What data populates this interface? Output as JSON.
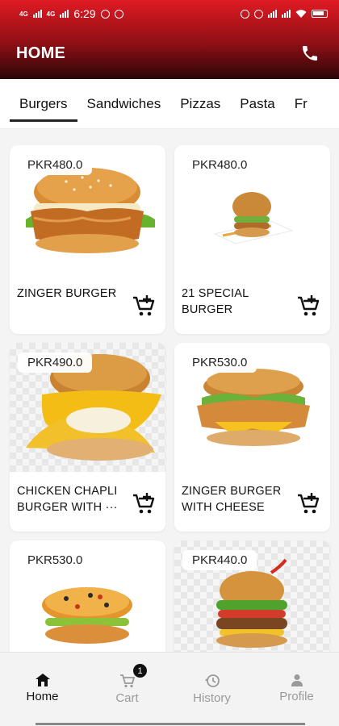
{
  "status_bar": {
    "time": "6:29",
    "battery": "82"
  },
  "header": {
    "title": "HOME",
    "icon": "phone-icon"
  },
  "tabs": [
    {
      "label": "Burgers",
      "active": true
    },
    {
      "label": "Sandwiches",
      "active": false
    },
    {
      "label": "Pizzas",
      "active": false
    },
    {
      "label": "Pasta",
      "active": false
    },
    {
      "label": "Fr",
      "active": false
    }
  ],
  "products": [
    {
      "price": "PKR480.0",
      "name": "ZINGER BURGER"
    },
    {
      "price": "PKR480.0",
      "name": "21 SPECIAL BURGER"
    },
    {
      "price": "PKR490.0",
      "name": "CHICKEN CHAPLI BURGER WITH ···"
    },
    {
      "price": "PKR530.0",
      "name": "ZINGER BURGER WITH CHEESE"
    },
    {
      "price": "PKR530.0",
      "name": ""
    },
    {
      "price": "PKR440.0",
      "name": ""
    }
  ],
  "bottom_nav": {
    "home": "Home",
    "cart": "Cart",
    "cart_badge": "1",
    "history": "History",
    "profile": "Profile"
  },
  "colors": {
    "header_top": "#e01b24",
    "header_bottom": "#2a0608",
    "accent_text": "#111111"
  }
}
